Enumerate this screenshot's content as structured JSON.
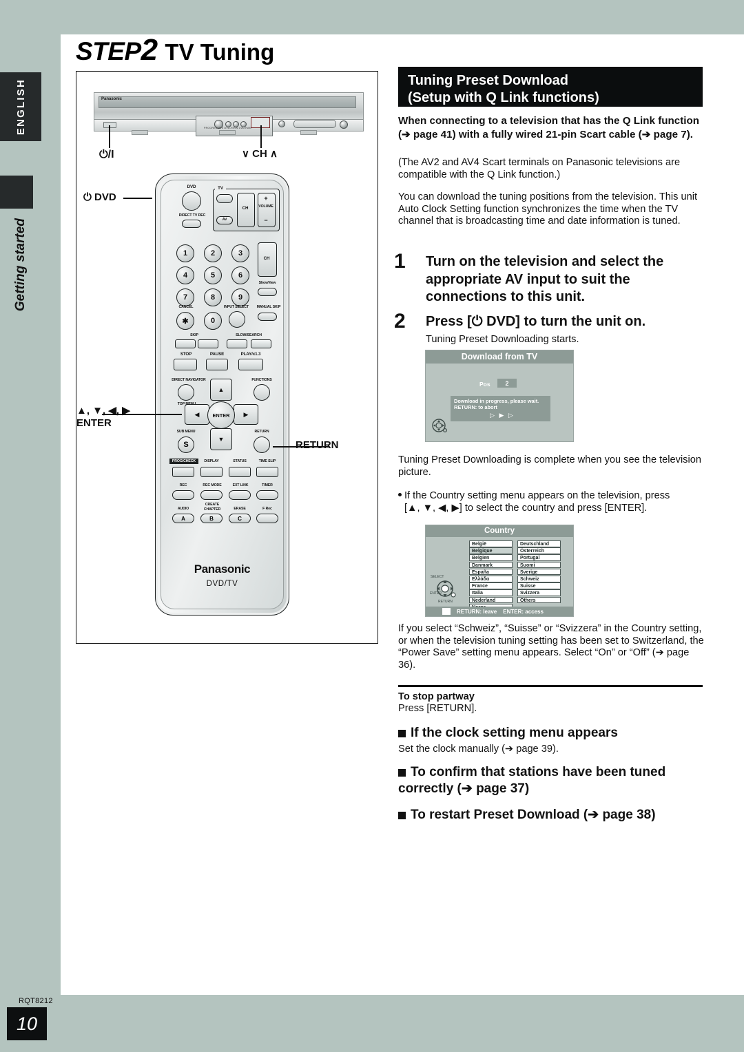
{
  "page": {
    "title_step_word": "STEP",
    "title_step_num": "2",
    "title_rest": "TV Tuning",
    "doc_code": "RQT8212",
    "page_number": "10"
  },
  "sidebar": {
    "language_tab": "ENGLISH",
    "section_label": "Getting started"
  },
  "illustration": {
    "unit_brand": "Panasonic",
    "unit_fine_print": "PROGRESSIVE  DVD-R/RW  DVD-RAM",
    "callouts": {
      "power": "⏻/I",
      "channel": "∨ CH ∧",
      "dvd_power": "⏻ DVD",
      "arrows_enter_line1": "▲, ▼, ◀, ▶",
      "arrows_enter_line2": "ENTER",
      "return": "RETURN"
    },
    "remote": {
      "dvd_label": "DVD",
      "tv_label": "TV",
      "direct_tv_rec": "DIRECT TV REC",
      "av_label": "AV",
      "ch_label": "CH",
      "volume_label": "VOLUME",
      "volume_plus": "+",
      "volume_minus": "−",
      "numbers": [
        "1",
        "2",
        "3",
        "4",
        "5",
        "6",
        "7",
        "8",
        "9",
        "✱",
        "0"
      ],
      "showview": "ShowView",
      "cancel": "CANCEL",
      "input_select": "INPUT SELECT",
      "manual_skip": "MANUAL SKIP",
      "skip": "SKIP",
      "slow_search": "SLOW/SEARCH",
      "stop": "STOP",
      "pause": "PAUSE",
      "play": "PLAY/x1.3",
      "direct_navigator": "DIRECT NAVIGATOR",
      "top_menu": "TOP MENU",
      "functions": "FUNCTIONS",
      "sub_menu": "SUB MENU",
      "return": "RETURN",
      "enter": "ENTER",
      "prog_check": "PROG/CHECK",
      "display": "DISPLAY",
      "status": "STATUS",
      "time_slip": "TIME SLIP",
      "rec": "REC",
      "rec_mode": "REC MODE",
      "ext_link": "EXT LINK",
      "timer": "TIMER",
      "audio": "AUDIO",
      "create_chapter_l1": "CREATE",
      "create_chapter_l2": "CHAPTER",
      "erase": "ERASE",
      "f_rec": "F Rec",
      "abc": [
        "A",
        "B",
        "C"
      ],
      "brand": "Panasonic",
      "model_text": "DVD/TV"
    }
  },
  "banner": {
    "line1": "Tuning Preset Download",
    "line2": "(Setup with Q Link functions)"
  },
  "intro": {
    "bold": "When connecting to a television that has the Q Link function (➔ page 41) with a fully wired 21-pin Scart cable (➔ page 7).",
    "paren": "(The AV2 and AV4 Scart terminals on Panasonic televisions are compatible with the Q Link function.)",
    "body": "You can download the tuning positions from the television. This unit Auto Clock Setting function synchronizes the time when the TV channel that is broadcasting time and date information is tuned."
  },
  "steps": [
    {
      "num": "1",
      "text": "Turn on the television and select the appropriate AV input to suit the connections to this unit."
    },
    {
      "num": "2",
      "text": "Press [⏻ DVD] to turn the unit on."
    }
  ],
  "step2_sub": "Tuning Preset Downloading starts.",
  "download_screen": {
    "title": "Download from TV",
    "pos_label": "Pos",
    "pos_value": "2",
    "message_line1": "Download in progress, please wait.",
    "message_line2": "RETURN: to abort",
    "arrows": "▷ ▶ ▷"
  },
  "after_download": "Tuning Preset Downloading is complete when you see the television picture.",
  "country_note_line1": "If the Country setting menu appears on the television, press",
  "country_note_line2": "[▲, ▼, ◀, ▶] to select the country and press [ENTER].",
  "country_screen": {
    "title": "Country",
    "column1": [
      "België",
      "Belgique",
      "Belgien",
      "Danmark",
      "España",
      "Ελλάδα",
      "France",
      "Italia",
      "Nederland",
      "Norge"
    ],
    "column1_selected_index": 1,
    "column2": [
      "Deutschland",
      "Österreich",
      "Portugal",
      "Suomi",
      "Sverige",
      "Schweiz",
      "Suisse",
      "Svizzera",
      "Others"
    ],
    "bottom_return": "RETURN: leave",
    "bottom_enter": "ENTER: access",
    "dial_select": "SELECT",
    "dial_enter": "ENTER",
    "dial_return": "RETURN"
  },
  "swiss_note": "If you select “Schweiz”, “Suisse” or “Svizzera” in the Country setting, or when the television tuning setting has been set to Switzerland, the “Power Save” setting menu appears. Select “On” or “Off” (➔ page 36).",
  "stop_partway": {
    "heading": "To stop partway",
    "body": "Press [RETURN]."
  },
  "subsections": [
    {
      "heading": "If the clock setting menu appears",
      "body": "Set the clock manually (➔ page 39)."
    },
    {
      "heading": "To confirm that stations have been tuned correctly (➔ page 37)",
      "body": ""
    },
    {
      "heading": "To restart Preset Download (➔ page 38)",
      "body": ""
    }
  ],
  "colors": {
    "page_background": "#b4c4bf",
    "content_background": "#ffffff",
    "banner_background": "#0b0d0e",
    "tv_screen_background": "#b9c4c0",
    "tv_screen_accent": "#8d9b96"
  }
}
